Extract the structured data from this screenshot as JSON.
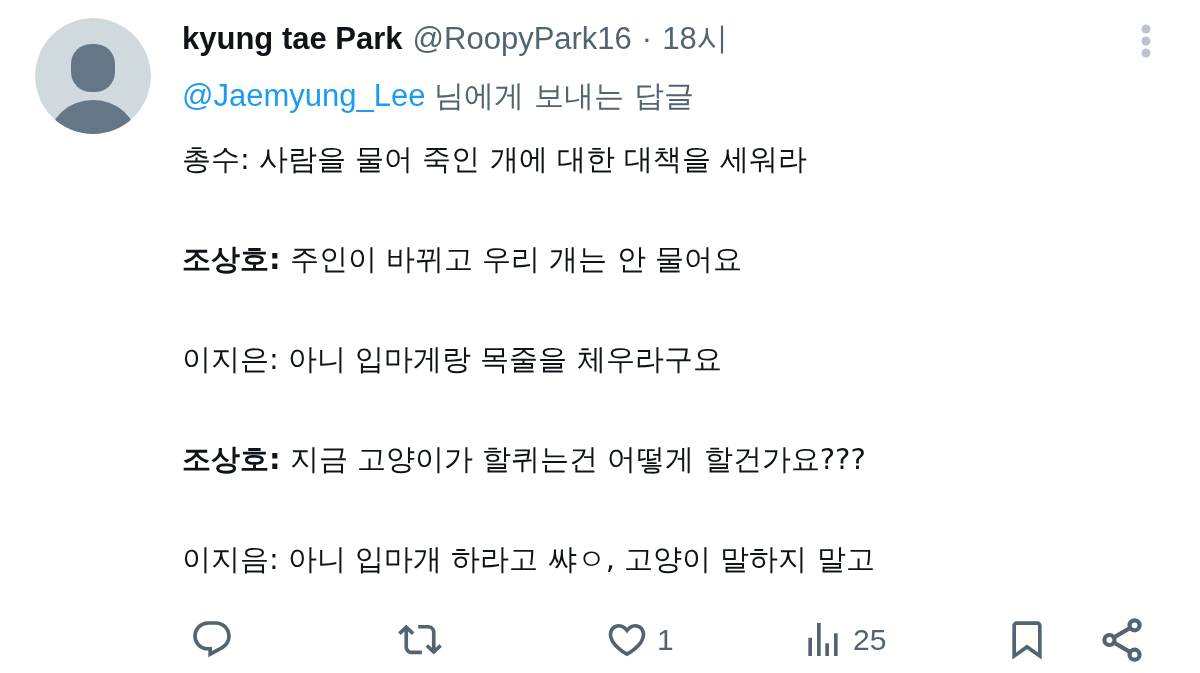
{
  "tweet": {
    "author": {
      "name": "kyung tae Park",
      "handle": "@RoopyPark16",
      "separator": "·",
      "time": "18시"
    },
    "reply_to": {
      "mention": "@Jaemyung_Lee",
      "text": "님에게 보내는 답글"
    },
    "paragraphs": [
      "총수: 사람을 물어 죽인 개에 대한 대책을 세워라",
      "**조상호:** 주인이 바뀌고 우리 개는 안 물어요",
      "이지은: 아니 입마게랑 목줄을 체우라구요",
      "**조상호:** 지금 고양이가 할퀴는건 어떻게 할건가요???",
      "이지음: 아니 입마개 하라고 쌰ㅇ, 고양이 말하지 말고"
    ],
    "actions": [
      {
        "kind": "reply"
      },
      {
        "kind": "retweet"
      },
      {
        "kind": "like",
        "count": "1"
      },
      {
        "kind": "views",
        "count": "25"
      },
      {
        "kind": "bookmark"
      },
      {
        "kind": "share"
      }
    ]
  }
}
